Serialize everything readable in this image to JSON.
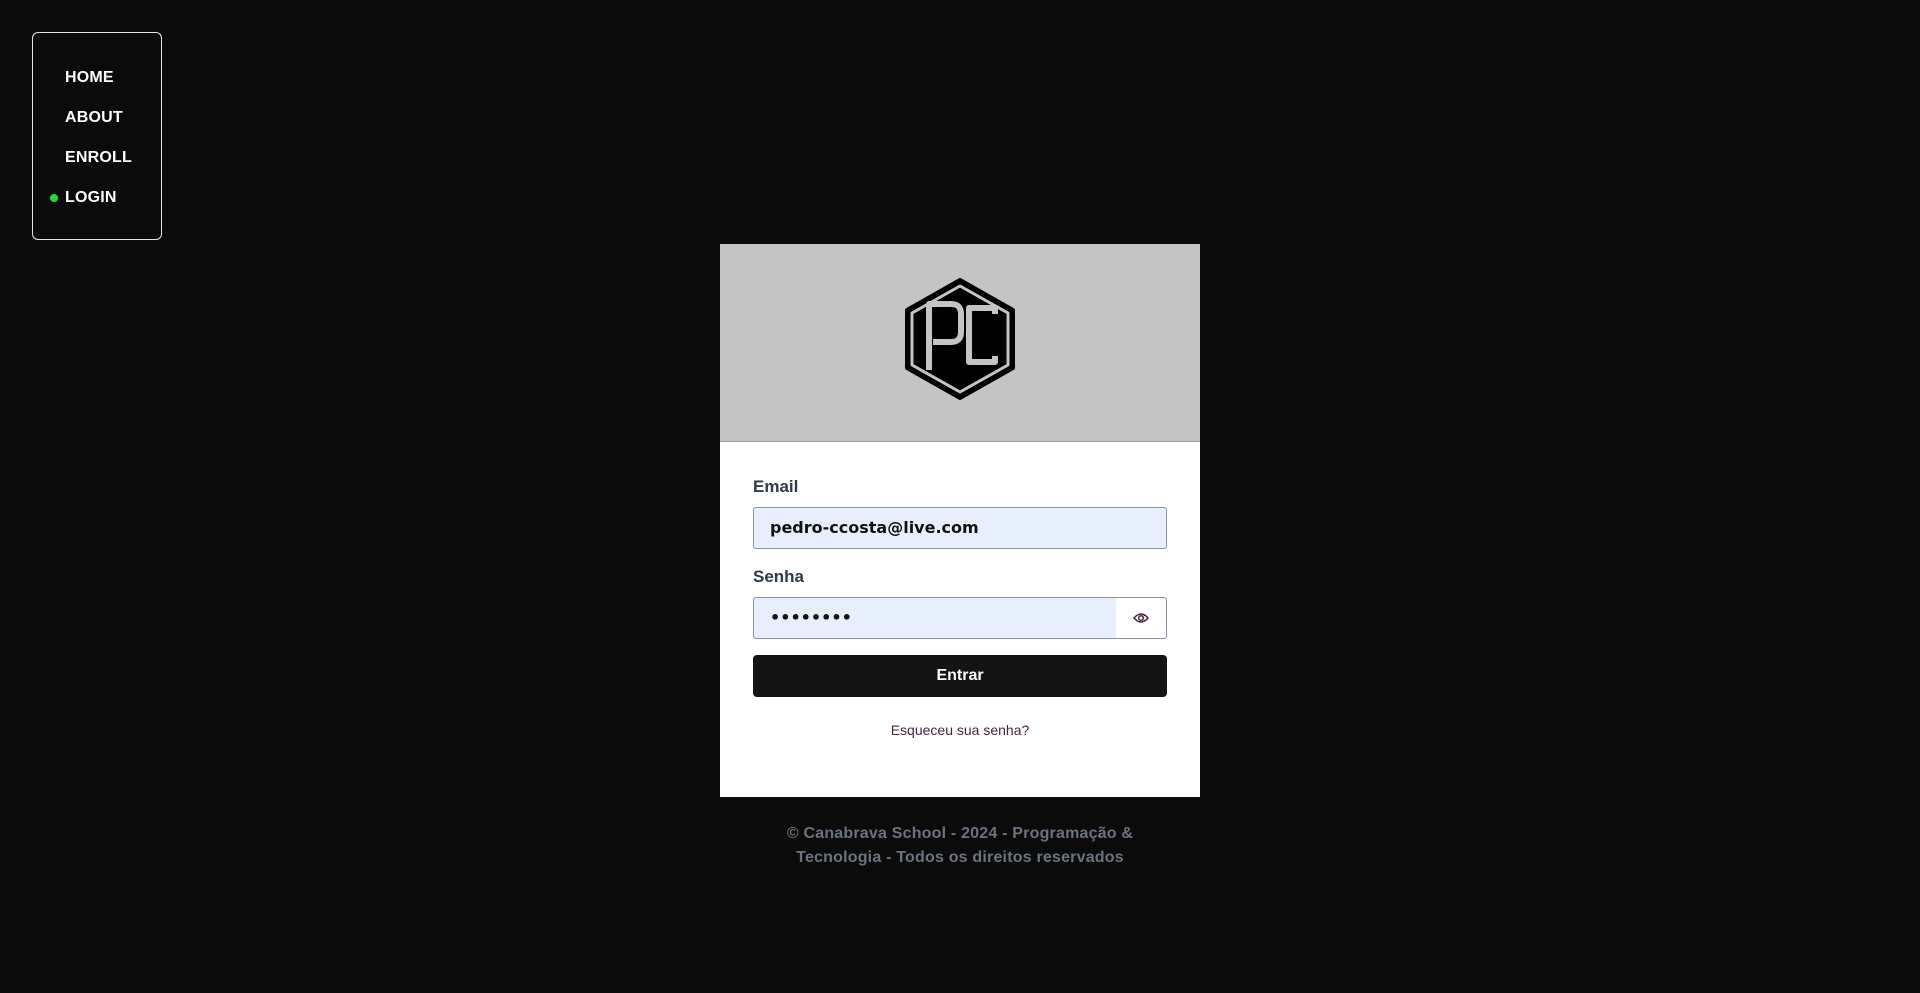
{
  "nav": {
    "items": [
      {
        "label": "HOME"
      },
      {
        "label": "ABOUT"
      },
      {
        "label": "ENROLL"
      },
      {
        "label": "LOGIN"
      }
    ],
    "active": "LOGIN",
    "active_color": "#22dd22"
  },
  "login": {
    "logo_icon": "pc-hexagon-logo",
    "email_label": "Email",
    "email_value": "pedro-ccosta@live.com",
    "password_label": "Senha",
    "password_value": "••••••••",
    "show_password_icon": "eye-icon",
    "submit_label": "Entrar",
    "forgot_link": "Esqueceu sua senha?"
  },
  "footer": {
    "line1": "© Canabrava School - 2024 - Programação &",
    "line2": "Tecnologia - Todos os direitos reservados"
  }
}
